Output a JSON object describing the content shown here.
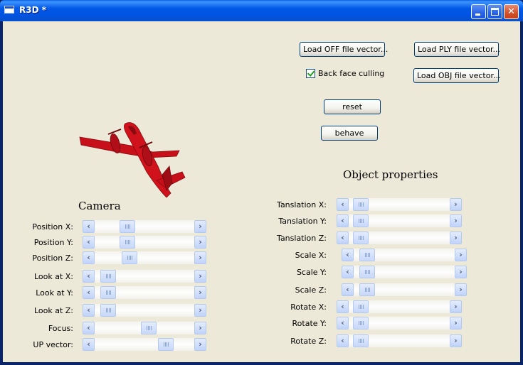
{
  "window": {
    "title": "R3D *"
  },
  "buttons": {
    "load_off": "Load OFF file vector...",
    "load_ply": "Load PLY file vector...",
    "load_obj": "Load OBJ file vector...",
    "reset": "reset",
    "behave": "behave"
  },
  "backface": {
    "label": "Back face culling",
    "checked": true
  },
  "camera": {
    "heading": "Camera",
    "rows": [
      {
        "label": "Position X:",
        "value": 0.3
      },
      {
        "label": "Position Y:",
        "value": 0.3
      },
      {
        "label": "Position Z:",
        "value": 0.32
      },
      {
        "label": "Look at X:",
        "value": 0.07
      },
      {
        "label": "Look at Y:",
        "value": 0.07
      },
      {
        "label": "Look at Z:",
        "value": 0.07
      },
      {
        "label": "Focus:",
        "value": 0.55
      },
      {
        "label": "UP vector:",
        "value": 0.75
      }
    ]
  },
  "object": {
    "heading": "Object properties",
    "rows": [
      {
        "label": "Tanslation X:",
        "value": 0.05
      },
      {
        "label": "Tanslation Y:",
        "value": 0.05
      },
      {
        "label": "Tanslation Z:",
        "value": 0.05
      },
      {
        "label": "Scale X:",
        "value": 0.07
      },
      {
        "label": "Scale Y:",
        "value": 0.07
      },
      {
        "label": "Scale Z:",
        "value": 0.07
      },
      {
        "label": "Rotate X:",
        "value": 0.05
      },
      {
        "label": "Rotate Y:",
        "value": 0.05
      },
      {
        "label": "Rotate Z:",
        "value": 0.05
      }
    ]
  },
  "colors": {
    "plane": "#c8101a",
    "plane_dark": "#7a0a0f",
    "titlebar": "#0054e3"
  },
  "icons": {
    "left_arrow": "chevron-left-icon",
    "right_arrow": "chevron-right-icon"
  }
}
